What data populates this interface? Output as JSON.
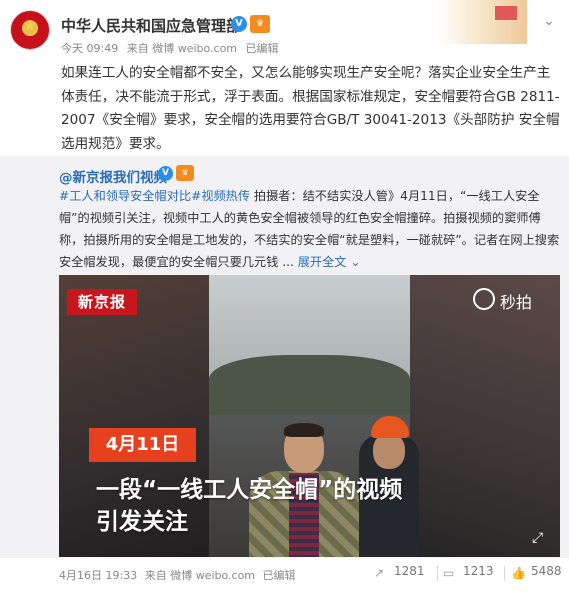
{
  "post": {
    "author": "中华人民共和国应急管理部",
    "meta": {
      "time": "今天 09:49",
      "source": "来自 微博 weibo.com",
      "edited": "已编辑"
    },
    "text": "如果连工人的安全帽都不安全，又怎么能够实现生产安全呢？落实企业安全生产主体责任，决不能流于形式，浮于表面。根据国家标准规定，安全帽要符合GB 2811-2007《安全帽》要求，安全帽的选用要符合GB/T 30041-2013《头部防护 安全帽选用规范》要求。"
  },
  "repost": {
    "author": "@新京报我们视频",
    "hashtag": "#工人和领导安全帽对比#",
    "video_tag": "视频热传",
    "text_part1": " 拍摄者：结不结实没人管》4月11日，“一线工人安全帽”的视频引关注，视频中工人的黄色安全帽被领导的红色安全帽撞碎。拍摄视频的窦师傅称，拍摄所用的安全帽是工地发的，不结实的安全帽“就是塑料，一碰就碎”。记者在网上搜索安全帽发现，最便宜的安全帽只要几元钱 ...",
    "expand": "展开全文",
    "expand_icon": "chevron-down-icon",
    "video": {
      "logo": "新京报",
      "watermark": "秒拍",
      "date_badge": "4月11日",
      "caption_line1": "一段“一线工人安全帽”的视频",
      "caption_line2": "引发关注"
    },
    "footer": {
      "time": "4月16日 19:33",
      "source": "来自 微博 weibo.com",
      "edited": "已编辑",
      "reposts": "1281",
      "comments": "1213",
      "likes": "5488"
    }
  },
  "colors": {
    "accent": "#eb7350",
    "link_blue": "#2b6db4",
    "vip": "#f58a1f",
    "verified": "#2b8ee8",
    "badge_red": "#e6401e"
  }
}
